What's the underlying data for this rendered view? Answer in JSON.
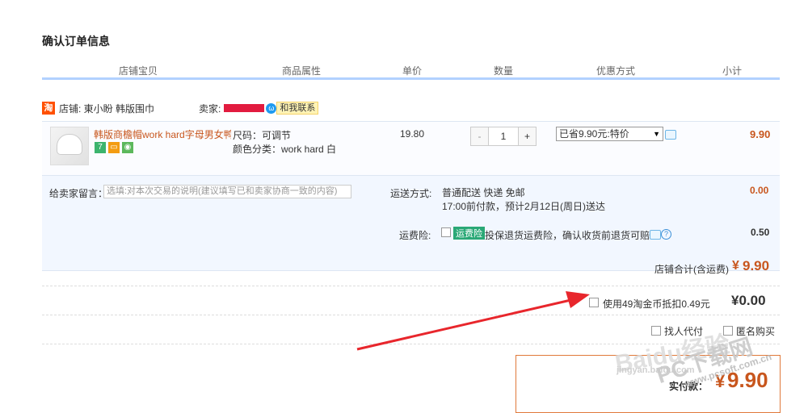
{
  "page_title": "确认订单信息",
  "header": {
    "shop_item": "店铺宝贝",
    "attributes": "商品属性",
    "unit_price": "单价",
    "quantity": "数量",
    "discount": "优惠方式",
    "subtotal": "小计"
  },
  "shop": {
    "icon_text": "淘",
    "shop_label": "店铺: 東小盼 韩版围巾",
    "seller_label": "卖家:",
    "contact_label": "和我联系"
  },
  "item": {
    "name": "韩版商檐帽work hard字母男女鸭...",
    "size": "尺码：可调节",
    "color": "颜色分类：work hard 白",
    "price": "19.80",
    "qty_minus": "-",
    "qty_value": "1",
    "qty_plus": "+",
    "discount_selected": "已省9.90元:特价",
    "subtotal": "9.90",
    "badges": [
      "7",
      "",
      ""
    ]
  },
  "message": {
    "label": "给卖家留言：",
    "placeholder": "选填:对本次交易的说明(建议填写已和卖家协商一致的内容)"
  },
  "shipping": {
    "label": "运送方式:",
    "method": "普通配送 快递 免邮",
    "eta": "17:00前付款，预计2月12日(周日)送达",
    "cost": "0.00"
  },
  "insurance": {
    "label": "运费险:",
    "tag": "运费险",
    "text": "投保退货运费险，确认收货前退货可赔...",
    "cost": "0.50"
  },
  "shop_total": {
    "label": "店铺合计(含运费)",
    "currency": "¥",
    "value": "9.90"
  },
  "coins": {
    "label": "使用49淘金币抵扣0.49元",
    "amount": "¥0.00"
  },
  "options": {
    "friend_pay": "找人代付",
    "anonymous": "匿名购买"
  },
  "pay": {
    "label": "实付款：",
    "currency": "¥",
    "value": "9.90"
  },
  "watermark": {
    "baidu": "Baidu经验",
    "jingyan": "jingyan.baidu.com",
    "pc": "PC下载网",
    "site": "www.pcsoft.com.cn"
  },
  "colors": {
    "accent_orange": "#c8561d",
    "header_border": "#b2d1ff",
    "panel_bg": "#f2f7ff",
    "arrow_red": "#e8262c",
    "pay_box_border": "#e0793a"
  }
}
